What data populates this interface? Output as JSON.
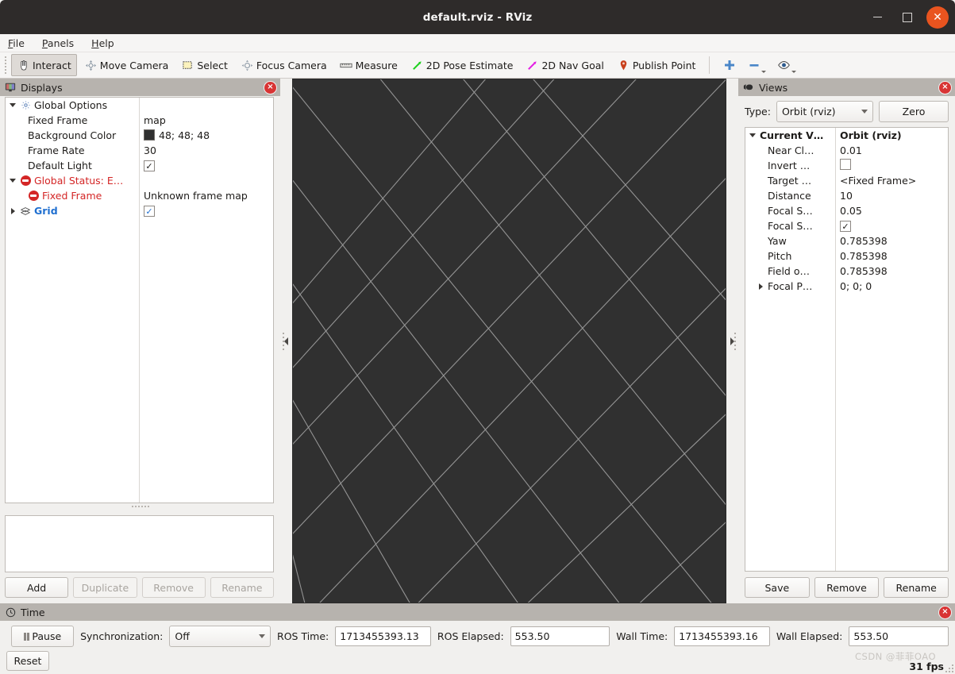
{
  "window": {
    "title": "default.rviz - RViz",
    "minimize_label": "minimize",
    "maximize_label": "maximize",
    "close_label": "close"
  },
  "menubar": [
    {
      "label": "File",
      "mnemonic": "F"
    },
    {
      "label": "Panels",
      "mnemonic": "P"
    },
    {
      "label": "Help",
      "mnemonic": "H"
    }
  ],
  "toolbar": {
    "items": [
      {
        "label": "Interact",
        "icon": "hand-cursor-icon",
        "active": true
      },
      {
        "label": "Move Camera",
        "icon": "move-camera-icon",
        "active": false
      },
      {
        "label": "Select",
        "icon": "select-rectangle-icon",
        "active": false
      },
      {
        "label": "Focus Camera",
        "icon": "focus-camera-icon",
        "active": false
      },
      {
        "label": "Measure",
        "icon": "ruler-icon",
        "active": false
      },
      {
        "label": "2D Pose Estimate",
        "icon": "green-arrow-icon",
        "active": false
      },
      {
        "label": "2D Nav Goal",
        "icon": "magenta-arrow-icon",
        "active": false
      },
      {
        "label": "Publish Point",
        "icon": "map-pin-icon",
        "active": false
      }
    ],
    "extra": [
      {
        "icon": "plus-icon",
        "label": "Add tool"
      },
      {
        "icon": "minus-icon",
        "label": "Remove tool"
      },
      {
        "icon": "eye-icon",
        "label": "Visibility"
      }
    ]
  },
  "displays": {
    "panel_title": "Displays",
    "panel_icon": "monitor-icon",
    "close_icon": "close-icon",
    "rows": [
      {
        "label": "Global Options",
        "value": "",
        "arrow": "down",
        "icon": "gear-icon",
        "indent": 0,
        "style": "normal"
      },
      {
        "label": "Fixed Frame",
        "value": "map",
        "arrow": "none",
        "icon": "none",
        "indent": 1,
        "style": "normal"
      },
      {
        "label": "Background Color",
        "value": "48; 48; 48",
        "arrow": "none",
        "icon": "none",
        "indent": 1,
        "style": "swatch",
        "swatch_color": "#303030"
      },
      {
        "label": "Frame Rate",
        "value": "30",
        "arrow": "none",
        "icon": "none",
        "indent": 1,
        "style": "normal"
      },
      {
        "label": "Default Light",
        "value": "✓",
        "arrow": "none",
        "icon": "none",
        "indent": 1,
        "style": "checkbox"
      },
      {
        "label": "Global Status: E…",
        "value": "",
        "arrow": "down",
        "icon": "error-icon",
        "indent": 0,
        "style": "error"
      },
      {
        "label": "Fixed Frame",
        "value": "Unknown frame map",
        "arrow": "none",
        "icon": "error-icon",
        "indent": 1,
        "style": "error"
      },
      {
        "label": "Grid",
        "value": "✓",
        "arrow": "right",
        "icon": "grid-icon",
        "indent": 0,
        "style": "selected-checkbox"
      }
    ],
    "buttons": [
      {
        "label": "Add",
        "enabled": true
      },
      {
        "label": "Duplicate",
        "enabled": false
      },
      {
        "label": "Remove",
        "enabled": false
      },
      {
        "label": "Rename",
        "enabled": false
      }
    ]
  },
  "views": {
    "panel_title": "Views",
    "panel_icon": "camera-icon",
    "close_icon": "close-icon",
    "type_label": "Type:",
    "type_value": "Orbit (rviz)",
    "zero_label": "Zero",
    "rows": [
      {
        "label": "Current V…",
        "value": "Orbit (rviz)",
        "arrow": "down",
        "indent": 0,
        "style": "bold"
      },
      {
        "label": "Near Cl…",
        "value": "0.01",
        "arrow": "none",
        "indent": 1,
        "style": "normal"
      },
      {
        "label": "Invert …",
        "value": "",
        "arrow": "none",
        "indent": 1,
        "style": "checkbox-empty"
      },
      {
        "label": "Target …",
        "value": "<Fixed Frame>",
        "arrow": "none",
        "indent": 1,
        "style": "normal"
      },
      {
        "label": "Distance",
        "value": "10",
        "arrow": "none",
        "indent": 1,
        "style": "normal"
      },
      {
        "label": "Focal S…",
        "value": "0.05",
        "arrow": "none",
        "indent": 1,
        "style": "normal"
      },
      {
        "label": "Focal S…",
        "value": "✓",
        "arrow": "none",
        "indent": 1,
        "style": "checkbox"
      },
      {
        "label": "Yaw",
        "value": "0.785398",
        "arrow": "none",
        "indent": 1,
        "style": "normal"
      },
      {
        "label": "Pitch",
        "value": "0.785398",
        "arrow": "none",
        "indent": 1,
        "style": "normal"
      },
      {
        "label": "Field o…",
        "value": "0.785398",
        "arrow": "none",
        "indent": 1,
        "style": "normal"
      },
      {
        "label": "Focal P…",
        "value": "0; 0; 0",
        "arrow": "right",
        "indent": 1,
        "style": "normal"
      }
    ],
    "buttons": [
      {
        "label": "Save",
        "enabled": true
      },
      {
        "label": "Remove",
        "enabled": true
      },
      {
        "label": "Rename",
        "enabled": true
      }
    ]
  },
  "time": {
    "panel_title": "Time",
    "panel_icon": "clock-icon",
    "close_icon": "close-icon",
    "pause_label": "Pause",
    "sync_label": "Synchronization:",
    "sync_value": "Off",
    "ros_time_label": "ROS Time:",
    "ros_time_value": "1713455393.13",
    "ros_elapsed_label": "ROS Elapsed:",
    "ros_elapsed_value": "553.50",
    "wall_time_label": "Wall Time:",
    "wall_time_value": "1713455393.16",
    "wall_elapsed_label": "Wall Elapsed:",
    "wall_elapsed_value": "553.50",
    "reset_label": "Reset"
  },
  "statusbar": {
    "fps": "31 fps",
    "watermark": "CSDN @菲菲OAO"
  },
  "viewport": {
    "background_color": "#303030",
    "grid_color": "#a0a0a0",
    "collapse_left_icon": "collapse-left-arrow-icon",
    "collapse_right_icon": "collapse-right-arrow-icon"
  }
}
